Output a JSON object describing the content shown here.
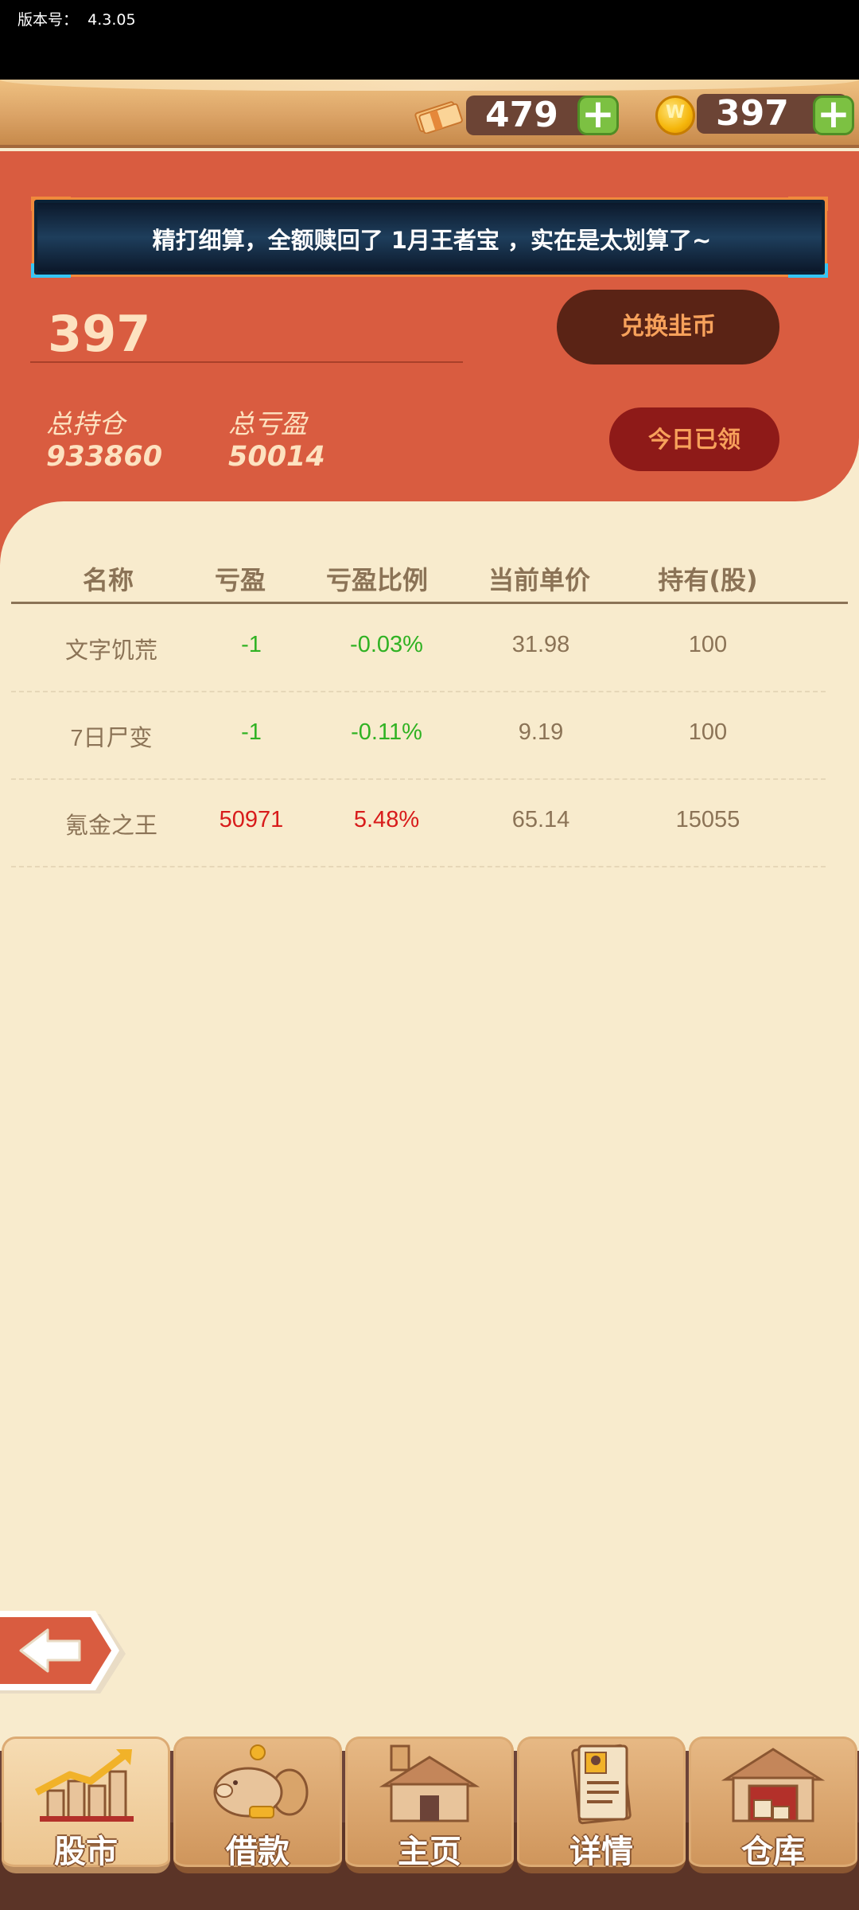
{
  "status_bar": {
    "version_label": "版本号：",
    "version": "4.3.05"
  },
  "resources": {
    "cash": "479",
    "coins": "397",
    "plus_symbol": "+"
  },
  "banner": {
    "text": "精打细算，全额赎回了 1月王者宝 ，实在是太划算了~"
  },
  "balance": "397",
  "buttons": {
    "exchange": "兑换韭币",
    "daily": "今日已领"
  },
  "stats": {
    "total_position_label": "总持仓",
    "total_position": "933860",
    "total_pnl_label": "总亏盈",
    "total_pnl": "50014"
  },
  "table": {
    "headers": [
      "名称",
      "亏盈",
      "亏盈比例",
      "当前单价",
      "持有(股)"
    ],
    "rows": [
      {
        "name": "文字饥荒",
        "pnl": "-1",
        "ratio": "-0.03%",
        "price": "31.98",
        "held": "100",
        "trend": "down"
      },
      {
        "name": "7日尸变",
        "pnl": "-1",
        "ratio": "-0.11%",
        "price": "9.19",
        "held": "100",
        "trend": "down"
      },
      {
        "name": "氪金之王",
        "pnl": "50971",
        "ratio": "5.48%",
        "price": "65.14",
        "held": "15055",
        "trend": "up"
      }
    ]
  },
  "nav": {
    "items": [
      {
        "label": "股市",
        "icon": "stock-chart-icon",
        "active": true
      },
      {
        "label": "借款",
        "icon": "piggy-bank-icon",
        "active": false
      },
      {
        "label": "主页",
        "icon": "house-icon",
        "active": false
      },
      {
        "label": "详情",
        "icon": "resume-icon",
        "active": false
      },
      {
        "label": "仓库",
        "icon": "warehouse-icon",
        "active": false
      }
    ]
  },
  "colors": {
    "panel_red": "#d95c40",
    "background_cream": "#f8ebcd",
    "loss_green": "#30b223",
    "gain_red": "#d81b1b",
    "button_orange_text": "#f7a15b"
  }
}
